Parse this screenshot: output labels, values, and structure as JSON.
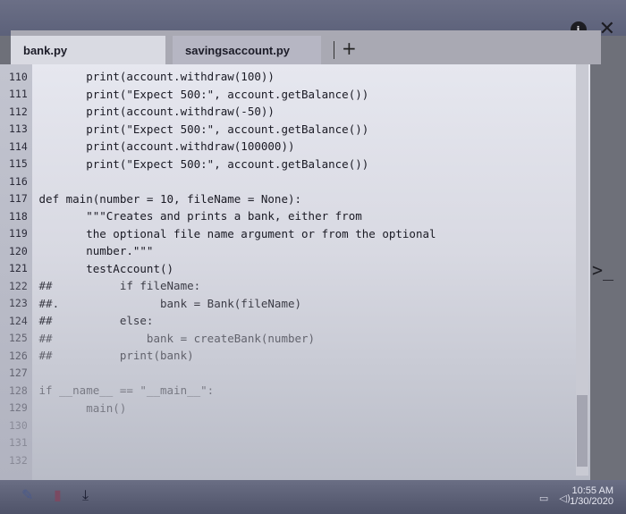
{
  "window": {
    "info_icon": "i",
    "close_icon": "✕"
  },
  "tabs": [
    {
      "label": "bank.py",
      "active": true
    },
    {
      "label": "savingsaccount.py",
      "active": false
    }
  ],
  "add_tab_label": "+",
  "code_lines": [
    {
      "num": "110",
      "text": "        print(account.withdraw(100))"
    },
    {
      "num": "111",
      "text": "        print(\"Expect 500:\", account.getBalance())"
    },
    {
      "num": "112",
      "text": "        print(account.withdraw(-50))"
    },
    {
      "num": "113",
      "text": "        print(\"Expect 500:\", account.getBalance())"
    },
    {
      "num": "114",
      "text": "        print(account.withdraw(100000))"
    },
    {
      "num": "115",
      "text": "        print(\"Expect 500:\", account.getBalance())"
    },
    {
      "num": "116",
      "text": ""
    },
    {
      "num": "117",
      "text": " def main(number = 10, fileName = None):"
    },
    {
      "num": "118",
      "text": "        \"\"\"Creates and prints a bank, either from"
    },
    {
      "num": "119",
      "text": "        the optional file name argument or from the optional"
    },
    {
      "num": "120",
      "text": "        number.\"\"\""
    },
    {
      "num": "121",
      "text": "        testAccount()"
    },
    {
      "num": "122",
      "text": " ##          if fileName:"
    },
    {
      "num": "123",
      "text": " ##.               bank = Bank(fileName)"
    },
    {
      "num": "124",
      "text": " ##          else:"
    },
    {
      "num": "125",
      "text": " ##              bank = createBank(number)"
    },
    {
      "num": "126",
      "text": " ##          print(bank)"
    },
    {
      "num": "127",
      "text": ""
    },
    {
      "num": "128",
      "text": " if __name__ == \"__main__\":"
    },
    {
      "num": "129",
      "text": "        main()"
    },
    {
      "num": "130",
      "text": ""
    },
    {
      "num": "131",
      "text": ""
    },
    {
      "num": "132",
      "text": ""
    }
  ],
  "shell_prompt": ">_",
  "toolbar": {
    "edit_icon": "✎",
    "trash_icon": "▮",
    "download_icon": "⤓"
  },
  "taskbar": {
    "time": "10:55 AM",
    "date": "1/30/2020"
  }
}
